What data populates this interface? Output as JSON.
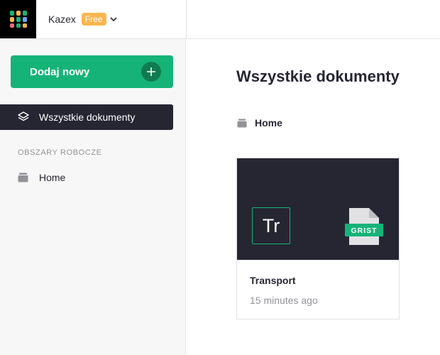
{
  "header": {
    "org_name": "Kazex",
    "plan_badge": "Free"
  },
  "sidebar": {
    "add_new_label": "Dodaj nowy",
    "all_documents_label": "Wszystkie dokumenty",
    "workspaces_header": "OBSZARY ROBOCZE",
    "workspaces": [
      {
        "label": "Home"
      }
    ]
  },
  "main": {
    "title": "Wszystkie dokumenty",
    "breadcrumb": "Home",
    "documents": [
      {
        "initials": "Tr",
        "name": "Transport",
        "modified": "15 minutes ago",
        "file_badge": "GRIST"
      }
    ]
  },
  "colors": {
    "accent_green": "#16b378",
    "dark_green": "#0f7b51",
    "dark_navy": "#262633",
    "badge_orange": "#fab64f",
    "muted_gray": "#929299"
  },
  "icons": {
    "logo": "grist-logo-icon",
    "plan_dropdown": "chevron-down-icon",
    "add": "plus-icon",
    "all_documents": "layers-icon",
    "workspace": "folder-icon",
    "document_file": "grist-file-icon"
  }
}
